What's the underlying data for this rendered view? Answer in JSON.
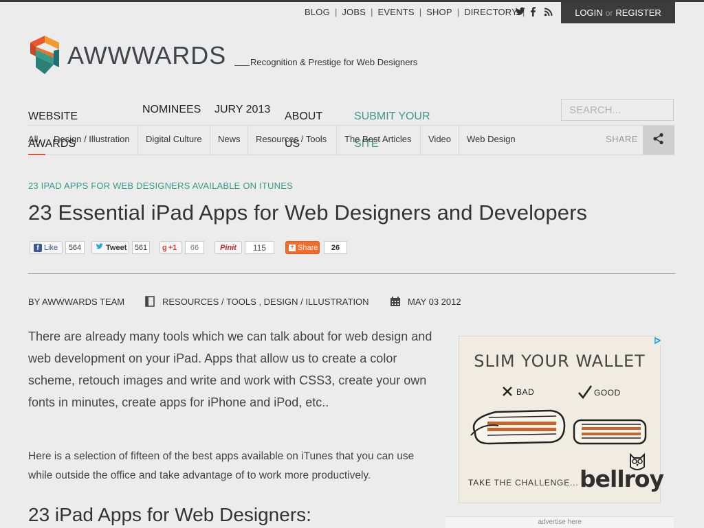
{
  "top_links": [
    "BLOG",
    "JOBS",
    "EVENTS",
    "SHOP",
    "DIRECTORY"
  ],
  "social_icons": [
    "twitter-icon",
    "facebook-icon",
    "rss-icon"
  ],
  "account": {
    "login": "LOGIN",
    "or": "or",
    "register": "REGISTER"
  },
  "logo": {
    "text": "AWWWARDS",
    "tagline": "Recognition & Prestige for Web Designers",
    "colors": [
      "#e8562f",
      "#f29a2e",
      "#3a9a8a",
      "#1f6e73"
    ]
  },
  "main_nav": {
    "website_awards": "WEBSITE AWARDS",
    "nominees": "NOMINEES",
    "jury": "JURY 2013",
    "about": "ABOUT US",
    "submit": "SUBMIT YOUR SITE"
  },
  "search": {
    "placeholder": "SEARCH..."
  },
  "categories": [
    "All",
    "Design / Illustration",
    "Digital Culture",
    "News",
    "Resources / Tools",
    "The Best Articles",
    "Video",
    "Web Design"
  ],
  "share_label": "SHARE",
  "article": {
    "kicker": "23 IPAD APPS FOR WEB DESIGNERS AVAILABLE ON ITUNES",
    "title": "23 Essential iPad Apps for Web Designers and Developers",
    "social_counts": {
      "like_label": "Like",
      "like": "564",
      "tweet_label": "Tweet",
      "tweet": "561",
      "plus_label": "+1",
      "plus": "66",
      "pin_label": "Pinit",
      "pin": "115",
      "share_label": "Share",
      "share": "26"
    },
    "author": "BY AWWWARDS TEAM",
    "category_1": "RESOURCES / TOOLS",
    "category_sep": ",",
    "category_2": "DESIGN / ILLUSTRATION",
    "date": "MAY 03 2012",
    "para1": "There are already many tools which we can talk about for web design and web development on your iPad. Apps that allow us to create a color scheme, retouch images and write and work with CSS3, create your own fonts in minutes, create apps for iPhone and iPod, etc..",
    "para2": "Here is a selection of fifteen of the best apps available on iTunes that you can use while outside the office and take advantage of to work more productively.",
    "subhead": "23 iPad Apps for Web Designers:"
  },
  "ad": {
    "headline": "SLIM YOUR WALLET",
    "bad": "BAD",
    "good": "GOOD",
    "cta": "TAKE THE CHALLENGE...",
    "brand": "bellroy",
    "advertise": "advertise here"
  }
}
